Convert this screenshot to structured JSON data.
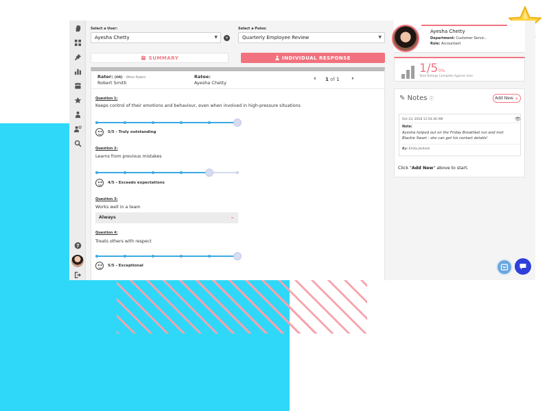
{
  "main": {
    "user_select": {
      "label": "Select a User:",
      "value": "Ayesha Chetty"
    },
    "pulse_select": {
      "label": "Select a Pulse:",
      "value": "Quarterly Employee Review"
    },
    "tabs": {
      "summary": "SUMMARY",
      "individual": "INDIVIDUAL RESPONSE"
    },
    "rater": {
      "label": "Rater:",
      "or": "[OR]",
      "other": "- Other Raters",
      "name": "Robert Smith"
    },
    "ratee": {
      "label": "Ratee:",
      "name": "Ayesha Chetty"
    },
    "pager": {
      "current": "1",
      "of": "of",
      "total": "1"
    },
    "questions": [
      {
        "title": "Question 1:",
        "text": "Keeps control of their emotions and behaviour, even when involved in high-pressure situations",
        "score": 5,
        "max": 5,
        "score_label": "5/5 - Truly outstanding"
      },
      {
        "title": "Question 2:",
        "text": "Learns from previous mistakes",
        "score": 4,
        "max": 5,
        "score_label": "4/5 - Exceeds expectations"
      },
      {
        "title": "Question 3:",
        "text": "Works well in a team",
        "answer": "Always"
      },
      {
        "title": "Question 4:",
        "text": "Treats others with respect",
        "score": 5,
        "max": 5,
        "score_label": "5/5 - Exceptional"
      }
    ]
  },
  "profile": {
    "name": "Ayesha Chetty",
    "department_label": "Department:",
    "department": "Customer Servic..",
    "role_label": "Role:",
    "role": "Accountant"
  },
  "rating": {
    "value": "1/5",
    "percent": "0%",
    "caption": "Total Ratings Complete Against User"
  },
  "notes": {
    "title": "Notes",
    "add_new": "Add New",
    "note": {
      "date": "Oct 23, 2018 11:54:36 AM",
      "label": "Note:",
      "body_line1": "Ayesha helped out on the Friday Breakfast run and met",
      "body_line2": "Blackie Swart - she can get his contact details!",
      "by_label": "By:",
      "by": "Emily Jackson"
    },
    "hint_prefix": "Click \"",
    "hint_bold": "Add New",
    "hint_suffix": "\" above to start."
  },
  "colors": {
    "accent_pink": "#f1727e",
    "slider_blue": "#3aa9e2",
    "bg_cyan": "#2fd8f8"
  },
  "icons": {
    "rail": [
      "hand-icon",
      "dashboard-icon",
      "pin-icon",
      "bar-chart-icon",
      "team-icon",
      "star-icon",
      "user-award-icon",
      "user-settings-icon",
      "search-icon",
      "help-icon",
      "logout-icon"
    ],
    "fabs": [
      "support-icon",
      "chat-icon"
    ]
  }
}
